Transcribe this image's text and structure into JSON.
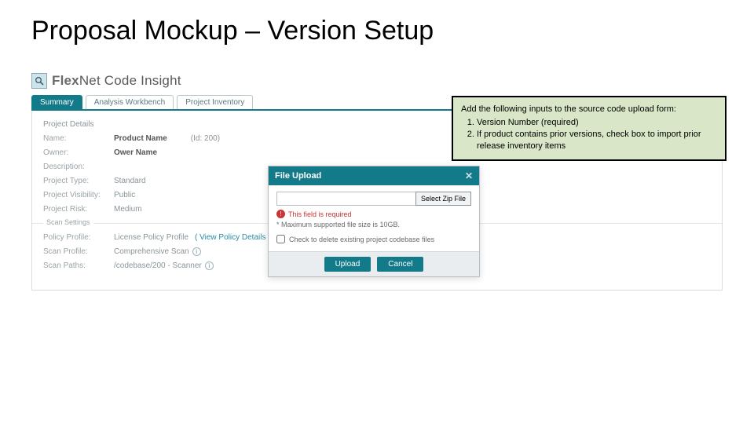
{
  "slide": {
    "title": "Proposal Mockup – Version Setup"
  },
  "brand": {
    "name_bold": "Flex",
    "name_rest": "Net Code Insight",
    "icon": "loupe-icon"
  },
  "tabs": [
    "Summary",
    "Analysis Workbench",
    "Project Inventory"
  ],
  "fieldset_details": "Project Details",
  "fields": {
    "name": {
      "label": "Name:",
      "value": "Product Name",
      "suffix": "(Id: 200)"
    },
    "owner": {
      "label": "Owner:",
      "value": "Ower Name"
    },
    "description": {
      "label": "Description:",
      "value": ""
    },
    "project_type": {
      "label": "Project Type:",
      "value": "Standard"
    },
    "visibility": {
      "label": "Project Visibility:",
      "value": "Public"
    },
    "risk": {
      "label": "Project Risk:",
      "value": "Medium"
    }
  },
  "scan": {
    "group_label": "Scan Settings",
    "policy": {
      "label": "Policy Profile:",
      "value": "License Policy Profile",
      "link": "( View Policy Details )"
    },
    "profile": {
      "label": "Scan Profile:",
      "value": "Comprehensive Scan"
    },
    "paths": {
      "label": "Scan Paths:",
      "value": "/codebase/200 - Scanner"
    }
  },
  "modal": {
    "title": "File Upload",
    "select_btn": "Select Zip File",
    "error": "This field is required",
    "hint": "* Maximum supported file size is 10GB.",
    "checkbox": "Check to delete existing project codebase files",
    "upload_btn": "Upload",
    "cancel_btn": "Cancel"
  },
  "callout": {
    "lead": "Add the following inputs to the source code upload form:",
    "items": [
      "Version Number (required)",
      "If product contains prior versions, check box to import prior release inventory items"
    ]
  }
}
